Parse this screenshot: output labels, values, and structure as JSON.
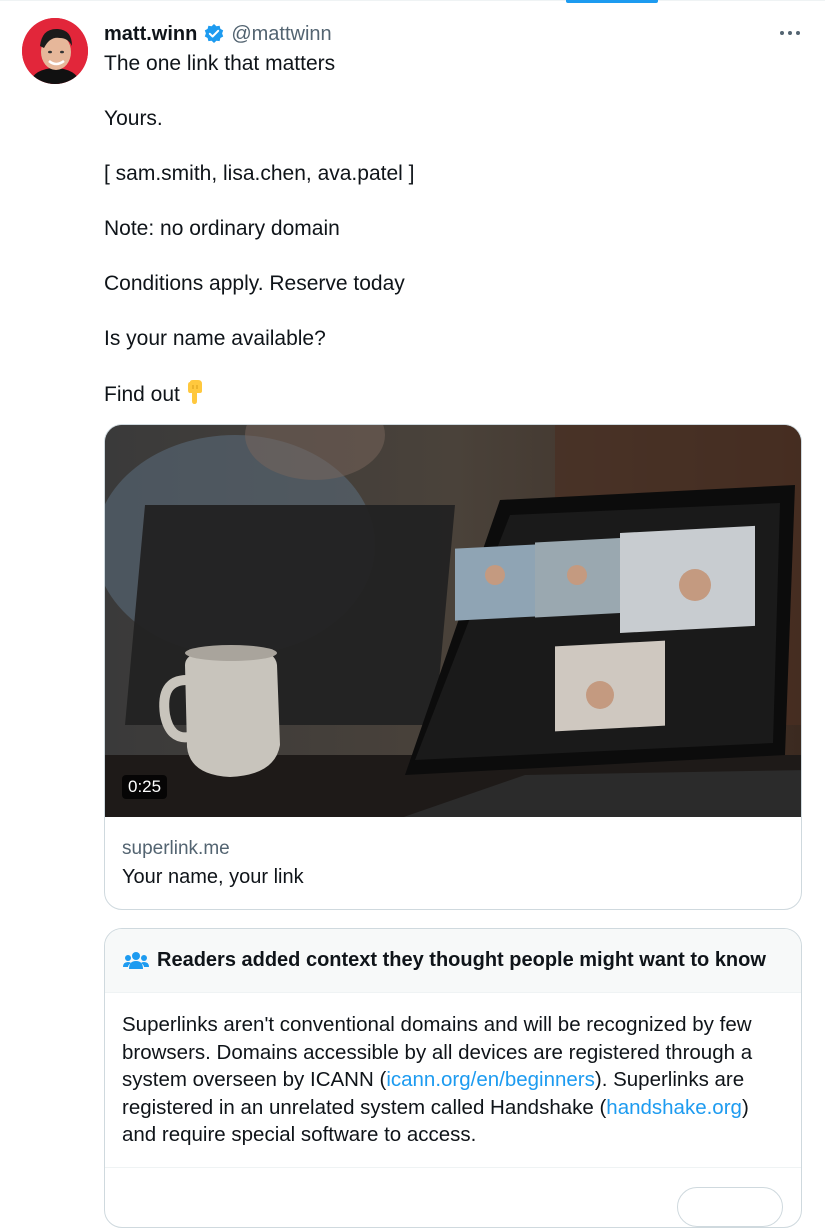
{
  "tweet": {
    "display_name": "matt.winn",
    "handle": "@mattwinn",
    "verified": true,
    "more_icon": "more-horizontal-icon",
    "lines": [
      "The one link that matters",
      "Yours.",
      "[ sam.smith, lisa.chen, ava.patel ]",
      "Note: no ordinary domain",
      "Conditions apply. Reserve today",
      "Is your name available?",
      "Find out"
    ],
    "pointing_emoji": "pointing-down-emoji"
  },
  "card": {
    "duration": "0:25",
    "domain": "superlink.me",
    "title": "Your name, your link"
  },
  "community_note": {
    "icon": "people-icon",
    "heading": "Readers added context they thought people might want to know",
    "body_part1": "Superlinks aren't conventional domains and will be recognized by few browsers. Domains accessible by all devices are registered through a system overseen by ICANN (",
    "link1": "icann.org/en/beginners",
    "body_part2": "). Superlinks are registered in an unrelated system called Handshake (",
    "link2": "handshake.org",
    "body_part3": ") and require special software to access."
  },
  "colors": {
    "accent": "#1d9bf0",
    "text": "#0f1419",
    "secondary": "#536471",
    "border": "#cfd9de"
  }
}
